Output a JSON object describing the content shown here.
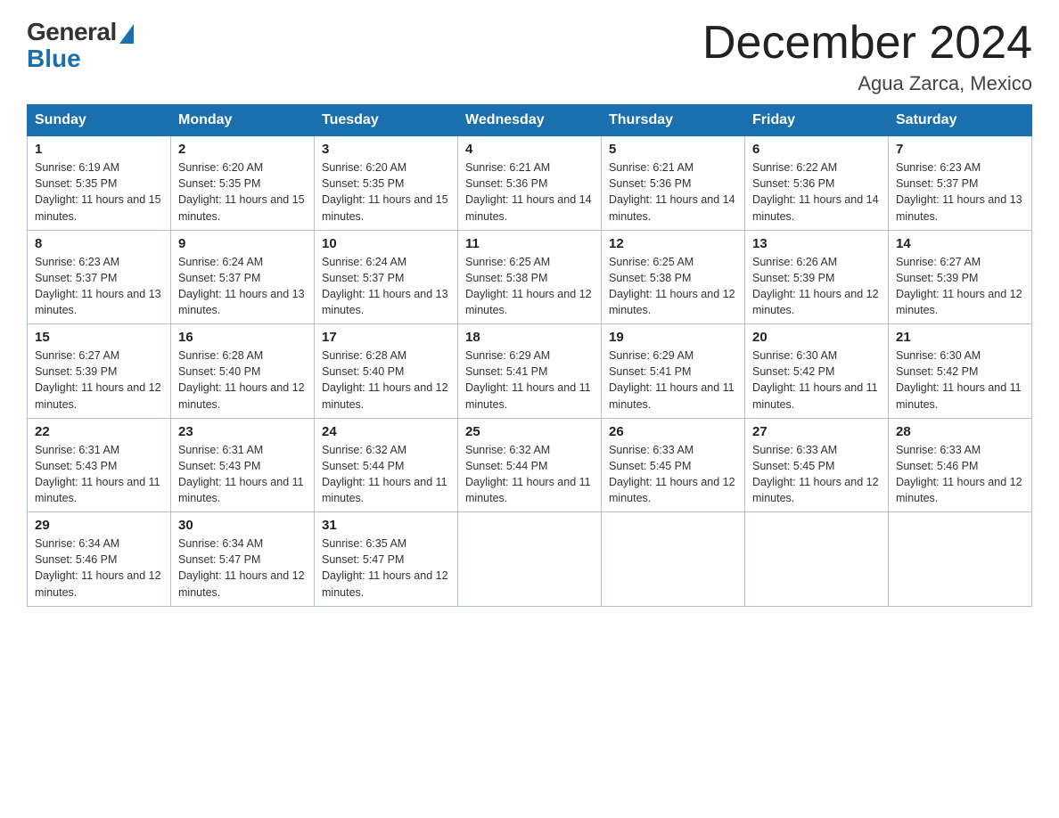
{
  "logo": {
    "general": "General",
    "blue": "Blue"
  },
  "header": {
    "title": "December 2024",
    "location": "Agua Zarca, Mexico"
  },
  "columns": [
    "Sunday",
    "Monday",
    "Tuesday",
    "Wednesday",
    "Thursday",
    "Friday",
    "Saturday"
  ],
  "weeks": [
    [
      {
        "day": "1",
        "sunrise": "6:19 AM",
        "sunset": "5:35 PM",
        "daylight": "11 hours and 15 minutes."
      },
      {
        "day": "2",
        "sunrise": "6:20 AM",
        "sunset": "5:35 PM",
        "daylight": "11 hours and 15 minutes."
      },
      {
        "day": "3",
        "sunrise": "6:20 AM",
        "sunset": "5:35 PM",
        "daylight": "11 hours and 15 minutes."
      },
      {
        "day": "4",
        "sunrise": "6:21 AM",
        "sunset": "5:36 PM",
        "daylight": "11 hours and 14 minutes."
      },
      {
        "day": "5",
        "sunrise": "6:21 AM",
        "sunset": "5:36 PM",
        "daylight": "11 hours and 14 minutes."
      },
      {
        "day": "6",
        "sunrise": "6:22 AM",
        "sunset": "5:36 PM",
        "daylight": "11 hours and 14 minutes."
      },
      {
        "day": "7",
        "sunrise": "6:23 AM",
        "sunset": "5:37 PM",
        "daylight": "11 hours and 13 minutes."
      }
    ],
    [
      {
        "day": "8",
        "sunrise": "6:23 AM",
        "sunset": "5:37 PM",
        "daylight": "11 hours and 13 minutes."
      },
      {
        "day": "9",
        "sunrise": "6:24 AM",
        "sunset": "5:37 PM",
        "daylight": "11 hours and 13 minutes."
      },
      {
        "day": "10",
        "sunrise": "6:24 AM",
        "sunset": "5:37 PM",
        "daylight": "11 hours and 13 minutes."
      },
      {
        "day": "11",
        "sunrise": "6:25 AM",
        "sunset": "5:38 PM",
        "daylight": "11 hours and 12 minutes."
      },
      {
        "day": "12",
        "sunrise": "6:25 AM",
        "sunset": "5:38 PM",
        "daylight": "11 hours and 12 minutes."
      },
      {
        "day": "13",
        "sunrise": "6:26 AM",
        "sunset": "5:39 PM",
        "daylight": "11 hours and 12 minutes."
      },
      {
        "day": "14",
        "sunrise": "6:27 AM",
        "sunset": "5:39 PM",
        "daylight": "11 hours and 12 minutes."
      }
    ],
    [
      {
        "day": "15",
        "sunrise": "6:27 AM",
        "sunset": "5:39 PM",
        "daylight": "11 hours and 12 minutes."
      },
      {
        "day": "16",
        "sunrise": "6:28 AM",
        "sunset": "5:40 PM",
        "daylight": "11 hours and 12 minutes."
      },
      {
        "day": "17",
        "sunrise": "6:28 AM",
        "sunset": "5:40 PM",
        "daylight": "11 hours and 12 minutes."
      },
      {
        "day": "18",
        "sunrise": "6:29 AM",
        "sunset": "5:41 PM",
        "daylight": "11 hours and 11 minutes."
      },
      {
        "day": "19",
        "sunrise": "6:29 AM",
        "sunset": "5:41 PM",
        "daylight": "11 hours and 11 minutes."
      },
      {
        "day": "20",
        "sunrise": "6:30 AM",
        "sunset": "5:42 PM",
        "daylight": "11 hours and 11 minutes."
      },
      {
        "day": "21",
        "sunrise": "6:30 AM",
        "sunset": "5:42 PM",
        "daylight": "11 hours and 11 minutes."
      }
    ],
    [
      {
        "day": "22",
        "sunrise": "6:31 AM",
        "sunset": "5:43 PM",
        "daylight": "11 hours and 11 minutes."
      },
      {
        "day": "23",
        "sunrise": "6:31 AM",
        "sunset": "5:43 PM",
        "daylight": "11 hours and 11 minutes."
      },
      {
        "day": "24",
        "sunrise": "6:32 AM",
        "sunset": "5:44 PM",
        "daylight": "11 hours and 11 minutes."
      },
      {
        "day": "25",
        "sunrise": "6:32 AM",
        "sunset": "5:44 PM",
        "daylight": "11 hours and 11 minutes."
      },
      {
        "day": "26",
        "sunrise": "6:33 AM",
        "sunset": "5:45 PM",
        "daylight": "11 hours and 12 minutes."
      },
      {
        "day": "27",
        "sunrise": "6:33 AM",
        "sunset": "5:45 PM",
        "daylight": "11 hours and 12 minutes."
      },
      {
        "day": "28",
        "sunrise": "6:33 AM",
        "sunset": "5:46 PM",
        "daylight": "11 hours and 12 minutes."
      }
    ],
    [
      {
        "day": "29",
        "sunrise": "6:34 AM",
        "sunset": "5:46 PM",
        "daylight": "11 hours and 12 minutes."
      },
      {
        "day": "30",
        "sunrise": "6:34 AM",
        "sunset": "5:47 PM",
        "daylight": "11 hours and 12 minutes."
      },
      {
        "day": "31",
        "sunrise": "6:35 AM",
        "sunset": "5:47 PM",
        "daylight": "11 hours and 12 minutes."
      },
      null,
      null,
      null,
      null
    ]
  ]
}
